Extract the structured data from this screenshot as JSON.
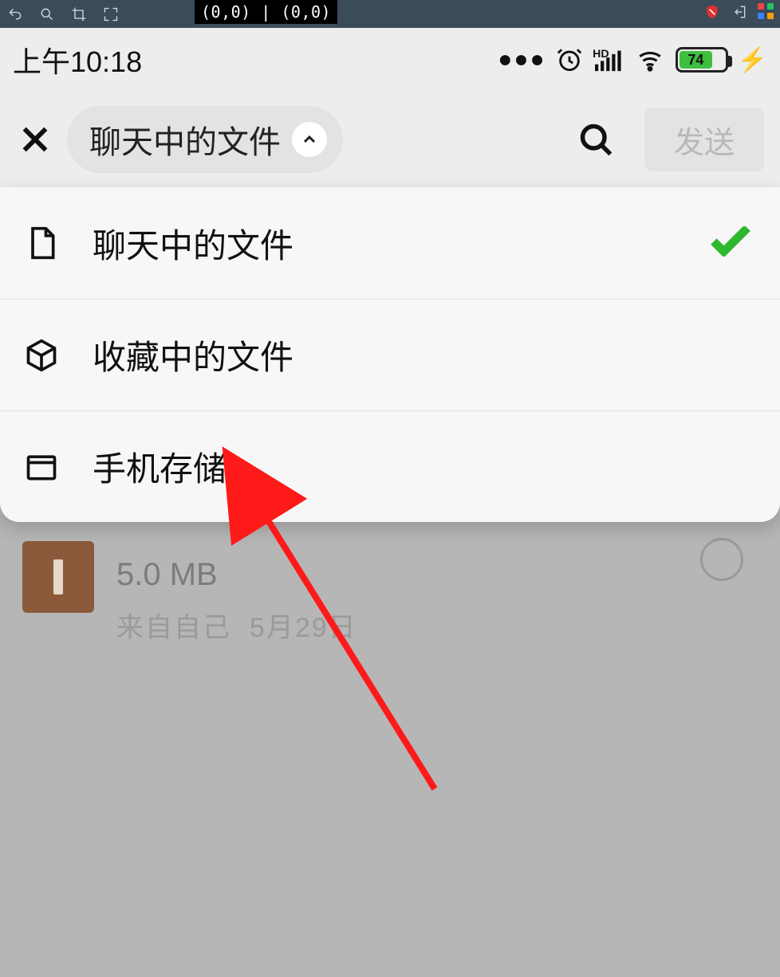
{
  "topbar": {
    "coords": "(0,0) | (0,0)"
  },
  "status": {
    "time": "上午10:18",
    "battery_pct": "74"
  },
  "header": {
    "dropdown_label": "聊天中的文件",
    "send_label": "发送"
  },
  "dropdown": {
    "items": [
      {
        "label": "聊天中的文件",
        "selected": true
      },
      {
        "label": "收藏中的文件",
        "selected": false
      },
      {
        "label": "手机存储",
        "selected": false
      }
    ]
  },
  "file": {
    "size": "5.0 MB",
    "source_prefix": "来自自己",
    "date": "5月29日"
  }
}
